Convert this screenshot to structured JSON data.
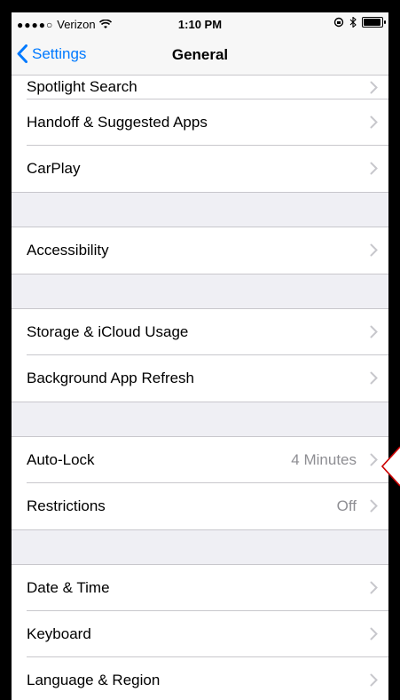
{
  "statusbar": {
    "signal_dots": "●●●●○",
    "carrier": "Verizon",
    "time": "1:10 PM"
  },
  "nav": {
    "back_label": "Settings",
    "title": "General"
  },
  "groups": [
    {
      "items": [
        {
          "label": "Spotlight Search",
          "value": ""
        },
        {
          "label": "Handoff & Suggested Apps",
          "value": ""
        },
        {
          "label": "CarPlay",
          "value": ""
        }
      ]
    },
    {
      "items": [
        {
          "label": "Accessibility",
          "value": ""
        }
      ]
    },
    {
      "items": [
        {
          "label": "Storage & iCloud Usage",
          "value": ""
        },
        {
          "label": "Background App Refresh",
          "value": ""
        }
      ]
    },
    {
      "items": [
        {
          "label": "Auto-Lock",
          "value": "4 Minutes"
        },
        {
          "label": "Restrictions",
          "value": "Off"
        }
      ]
    },
    {
      "items": [
        {
          "label": "Date & Time",
          "value": ""
        },
        {
          "label": "Keyboard",
          "value": ""
        },
        {
          "label": "Language & Region",
          "value": ""
        }
      ]
    }
  ],
  "colors": {
    "accent": "#007aff",
    "pointer": "#cc0000"
  }
}
